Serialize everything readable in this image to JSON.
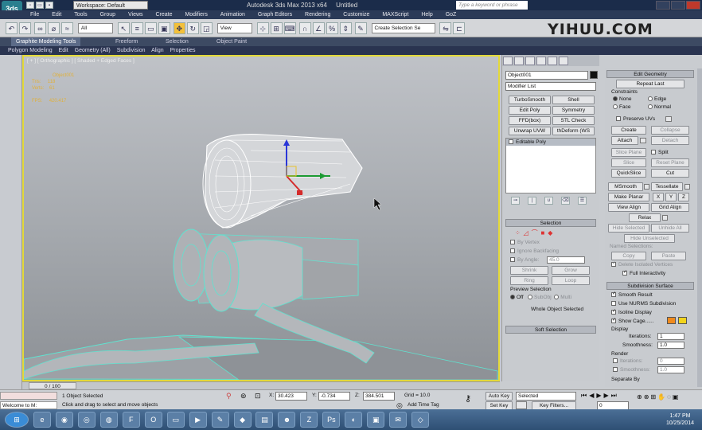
{
  "title_bar": {
    "app_logo": "3ds-max-logo",
    "workspace_label": "Workspace: Default",
    "app_title": "Autodesk 3ds Max  2013 x64",
    "doc_title": "Untitled",
    "search_placeholder": "Type a keyword or phrase"
  },
  "menu": [
    "File",
    "Edit",
    "Tools",
    "Group",
    "Views",
    "Create",
    "Modifiers",
    "Animation",
    "Graph Editors",
    "Rendering",
    "Customize",
    "MAXScript",
    "Help",
    "GoZ"
  ],
  "toolbar": {
    "filter_select": "All",
    "view_select": "View",
    "selection_set": "Create Selection Se"
  },
  "watermark": "YIHUU.COM",
  "ribbon_tabs": [
    "Graphite Modeling Tools",
    "Freeform",
    "Selection",
    "Object Paint"
  ],
  "ribbon_sub": [
    "Polygon Modeling",
    "Edit",
    "Geometry (All)",
    "Subdivision",
    "Align",
    "Properties"
  ],
  "viewport": {
    "label": "[ + ] [ Orthographic ] [ Shaded + Edged Faces ]",
    "stats_object": "Object001",
    "stats_tris_label": "Tris:",
    "stats_tris": "118",
    "stats_verts_label": "Verts:",
    "stats_verts": "61",
    "stats_fps_label": "FPS:",
    "stats_fps": "420.417"
  },
  "command_panel": {
    "object_name": "Object001",
    "modifier_list": "Modifier List",
    "modifier_buttons": [
      "TurboSmooth",
      "Shell",
      "Edit Poly",
      "Symmetry",
      "FFD(box)",
      "STL Check",
      "Unwrap UVW",
      "thDeform (WS"
    ],
    "stack_item": "Editable Poly",
    "selection_rollout": "Selection",
    "by_vertex": "By Vertex",
    "ignore_backfacing": "Ignore Backfacing",
    "by_angle": "By Angle:",
    "by_angle_value": "45.0",
    "shrink": "Shrink",
    "grow": "Grow",
    "ring": "Ring",
    "loop": "Loop",
    "preview_selection": "Preview Selection",
    "preview_off": "Off",
    "preview_subobj": "SubObj",
    "preview_multi": "Multi",
    "whole_object_selected": "Whole Object Selected",
    "soft_selection_rollout": "Soft Selection"
  },
  "edit_geometry": {
    "rollout": "Edit Geometry",
    "repeat_last": "Repeat Last",
    "constraints": "Constraints",
    "none": "None",
    "edge": "Edge",
    "face": "Face",
    "normal": "Normal",
    "preserve_uvs": "Preserve UVs",
    "create": "Create",
    "collapse": "Collapse",
    "attach": "Attach",
    "detach": "Detach",
    "slice_plane": "Slice Plane",
    "split": "Split",
    "slice": "Slice",
    "reset_plane": "Reset Plane",
    "quickslice": "QuickSlice",
    "cut": "Cut",
    "msmooth": "MSmooth",
    "tessellate": "Tessellate",
    "make_planar": "Make Planar",
    "x": "X",
    "y": "Y",
    "z": "Z",
    "view_align": "View Align",
    "grid_align": "Grid Align",
    "relax": "Relax",
    "hide_selected": "Hide Selected",
    "unhide_all": "Unhide All",
    "hide_unselected": "Hide Unselected",
    "named_selections": "Named Selections:",
    "copy": "Copy",
    "paste": "Paste",
    "delete_isolated": "Delete Isolated Vertices",
    "full_interactivity": "Full Interactivity"
  },
  "subdivision_surface": {
    "rollout": "Subdivision Surface",
    "smooth_result": "Smooth Result",
    "use_nurms": "Use NURMS Subdivision",
    "isoline_display": "Isoline Display",
    "show_cage": "Show Cage......",
    "display": "Display",
    "iterations_label": "Iterations:",
    "iterations": "1",
    "smoothness_label": "Smoothness:",
    "smoothness": "1.0",
    "render": "Render",
    "render_iterations": "0",
    "render_smoothness": "1.0",
    "separate_by": "Separate By",
    "cage_color_1": "#f08a1c",
    "cage_color_2": "#f2d41c"
  },
  "timeline": {
    "frame": "0 / 100"
  },
  "status": {
    "selection": "1 Object Selected",
    "prompt": "Click and drag to select and move objects",
    "maxscript_label": "Welcome to M:",
    "x_label": "X:",
    "x_value": "30.423",
    "y_label": "Y:",
    "y_value": "-0.734",
    "z_label": "Z:",
    "z_value": "384.501",
    "grid": "Grid = 10.0",
    "add_time_tag": "Add Time Tag",
    "auto_key": "Auto Key",
    "set_key": "Set Key",
    "selected": "Selected",
    "key_filters": "Key Filters...",
    "frame_value": "0"
  },
  "taskbar": {
    "apps": [
      "ie-icon",
      "firefox-icon",
      "chrome-icon",
      "filezilla-icon",
      "opera-icon",
      "folder-icon",
      "media-icon",
      "paint-icon",
      "dropbox-icon",
      "people-icon",
      "photoshop-icon",
      "zbrush-icon",
      "ps-icon",
      "app-icon",
      "max-icon",
      "mail-icon",
      "unity-icon"
    ],
    "time": "1:47 PM",
    "date": "10/25/2014"
  }
}
